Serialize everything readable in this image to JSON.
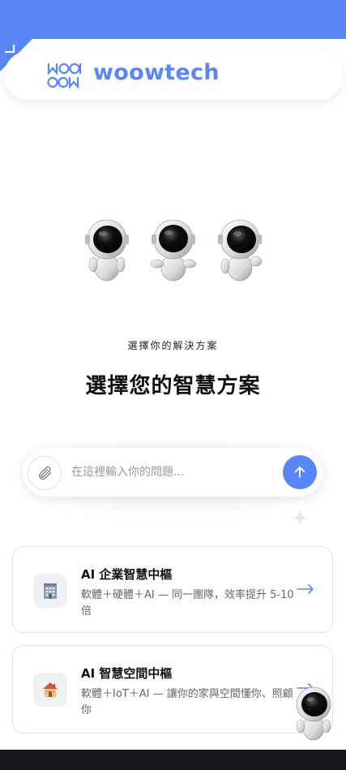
{
  "header": {
    "brand": "woowtech"
  },
  "hero": {
    "subtitle": "選擇你的解決方案",
    "title": "選擇您的智慧方案"
  },
  "search": {
    "placeholder": "在這裡輸入你的問題..."
  },
  "cards": [
    {
      "title": "AI 企業智慧中樞",
      "desc": "軟體＋硬體＋AI — 同一團隊，效率提升 5-10 倍",
      "icon": "office-building-icon"
    },
    {
      "title": "AI 智慧空間中樞",
      "desc": "軟體＋IoT＋AI — 讓你的家與空間懂你、照顧你",
      "icon": "house-icon"
    }
  ],
  "colors": {
    "accent": "#5b86f7",
    "bottom": "#16161a"
  }
}
